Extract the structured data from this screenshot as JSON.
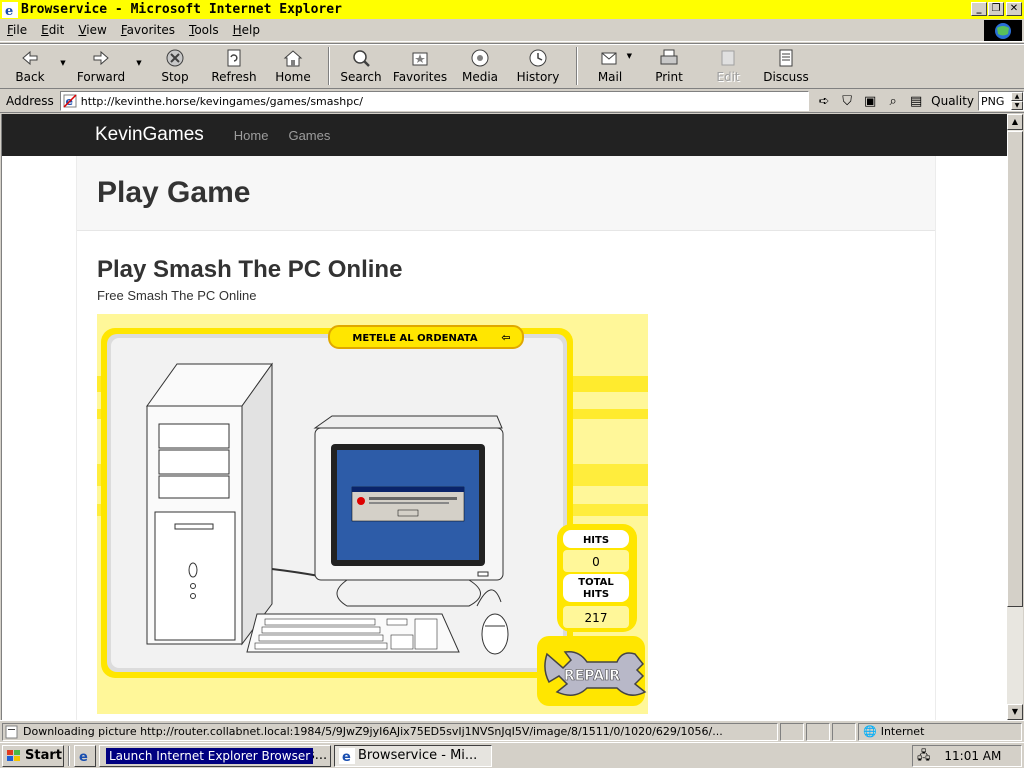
{
  "window": {
    "title": "Browservice - Microsoft Internet Explorer"
  },
  "menu": {
    "items": [
      {
        "key": "F",
        "rest": "ile"
      },
      {
        "key": "E",
        "rest": "dit"
      },
      {
        "key": "V",
        "rest": "iew"
      },
      {
        "key": "F",
        "rest": "avorites",
        "pre": ""
      },
      {
        "key": "T",
        "rest": "ools"
      },
      {
        "key": "H",
        "rest": "elp"
      }
    ]
  },
  "toolbar": {
    "back": "Back",
    "forward": "Forward",
    "stop": "Stop",
    "refresh": "Refresh",
    "home": "Home",
    "search": "Search",
    "favorites": "Favorites",
    "media": "Media",
    "history": "History",
    "mail": "Mail",
    "print": "Print",
    "edit": "Edit",
    "discuss": "Discuss"
  },
  "address": {
    "label": "Address",
    "url": "http://kevinthe.horse/kevingames/games/smashpc/",
    "quality_label": "Quality",
    "quality_value": "PNG"
  },
  "site": {
    "brand": "KevinGames",
    "nav": [
      "Home",
      "Games"
    ],
    "page_title": "Play Game",
    "heading": "Play Smash The PC Online",
    "subheading": "Free Smash The PC Online"
  },
  "game": {
    "banner": "METELE AL ORDENATA",
    "hits_label": "HITS",
    "hits_value": "0",
    "total_label_1": "TOTAL",
    "total_label_2": "HITS",
    "total_value": "217",
    "repair": "REPAIR",
    "colors": {
      "yellow": "#ffe600",
      "pale": "#fff799",
      "orange": "#f5c400"
    }
  },
  "status": {
    "text": "Downloading picture http://router.collabnet.local:1984/5/9JwZ9jyI6AJix75ED5svIj1NVSnJqI5V/image/8/1511/0/1020/629/1056/...",
    "zone": "Internet"
  },
  "taskbar": {
    "start": "Start",
    "task1": "Launch Internet Explorer Browser",
    "task1_tail": "os...",
    "task2": "Browservice - Mi...",
    "clock": "11:01 AM"
  }
}
